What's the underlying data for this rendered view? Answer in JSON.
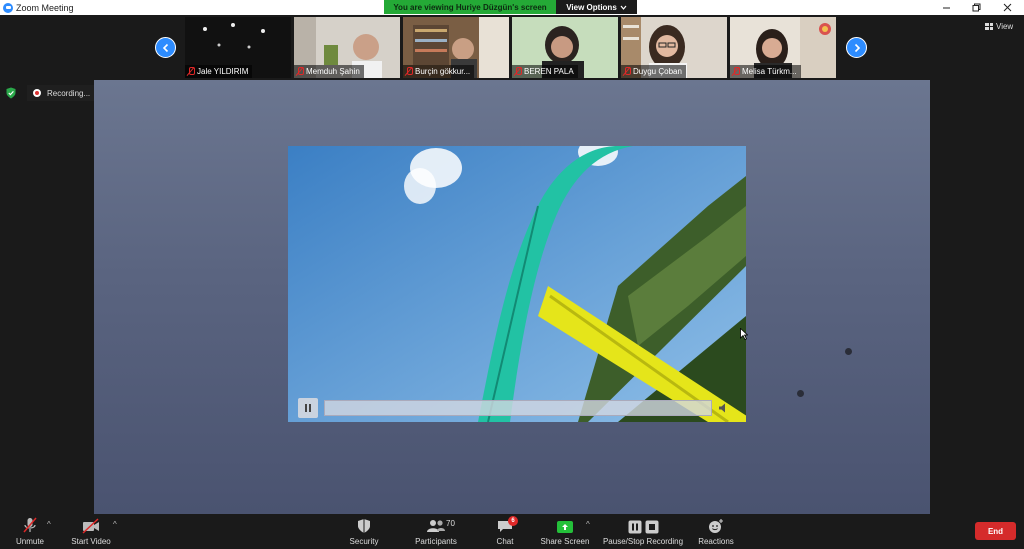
{
  "window": {
    "title": "Zoom Meeting",
    "viewing_banner": "You are viewing Huriye Düzgün's screen",
    "view_options": "View Options",
    "view_toggle": "View"
  },
  "participants_strip": [
    {
      "name": "Jale YILDIRIM",
      "muted": true,
      "bg": "#1c1c1c"
    },
    {
      "name": "Memduh Şahin",
      "muted": true,
      "bg": "#cfcac3"
    },
    {
      "name": "Burçin gökkur...",
      "muted": true,
      "bg": "#8a6f55"
    },
    {
      "name": "BEREN PALA",
      "muted": true,
      "bg": "#b8d4b0"
    },
    {
      "name": "Duygu Çoban",
      "muted": true,
      "bg": "#d8d3cc"
    },
    {
      "name": "Melisa Türkm...",
      "muted": true,
      "bg": "#e4dccf"
    }
  ],
  "recording": {
    "label": "Recording..."
  },
  "toolbar": {
    "unmute": "Unmute",
    "start_video": "Start Video",
    "security": "Security",
    "participants": "Participants",
    "participants_count": "70",
    "chat": "Chat",
    "chat_badge": "6",
    "share_screen": "Share Screen",
    "pause_stop_recording": "Pause/Stop Recording",
    "reactions": "Reactions",
    "end": "End"
  },
  "colors": {
    "accent_blue": "#2d8cff",
    "share_green": "#24a936",
    "end_red": "#d52b2b"
  }
}
